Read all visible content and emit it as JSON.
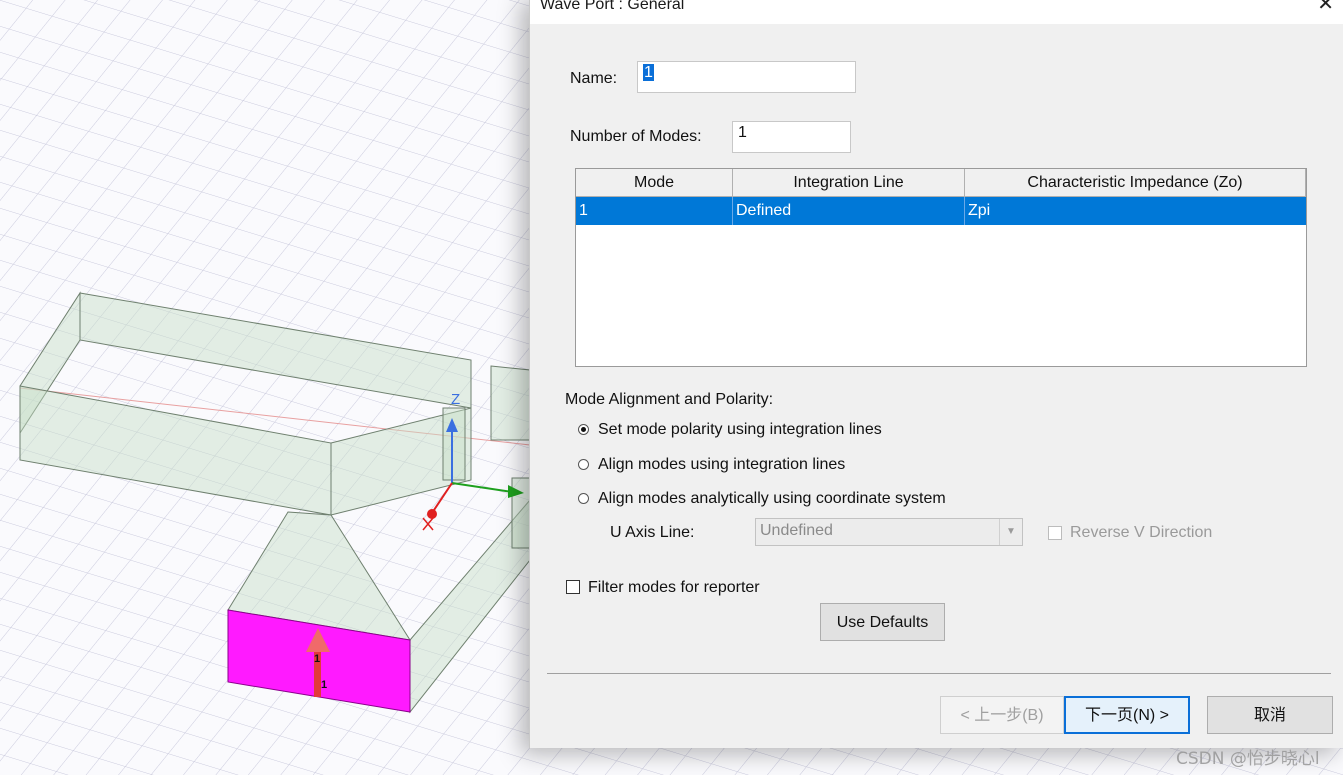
{
  "dialog": {
    "title": "Wave Port : General",
    "close_glyph": "✕",
    "name_label": "Name:",
    "name_value": "1",
    "modes_label": "Number of Modes:",
    "modes_value": "1",
    "table": {
      "headers": [
        "Mode",
        "Integration Line",
        "Characteristic Impedance (Zo)"
      ],
      "rows": [
        [
          "1",
          "Defined",
          "Zpi"
        ]
      ]
    },
    "alignment_heading": "Mode Alignment and Polarity:",
    "radio_options": [
      {
        "label": "Set mode polarity using integration lines",
        "selected": true
      },
      {
        "label": "Align modes using integration lines",
        "selected": false
      },
      {
        "label": "Align modes analytically using coordinate system",
        "selected": false
      }
    ],
    "u_axis_label": "U Axis Line:",
    "u_axis_value": "Undefined",
    "reverse_v_label": "Reverse V Direction",
    "filter_label": "Filter modes for reporter",
    "use_defaults_label": "Use Defaults",
    "back_label": "< 上一步(B)",
    "next_label": "下一页(N) >",
    "cancel_label": "取消"
  },
  "viewport": {
    "axis_z": "Z",
    "port_labels": [
      "1",
      "1"
    ],
    "colors": {
      "port_face": "#ff1aff",
      "axis_z": "#3a6fe0",
      "axis_y": "#1ea01e",
      "axis_x": "#e02020"
    }
  },
  "watermark": "CSDN @怡步晓心l"
}
